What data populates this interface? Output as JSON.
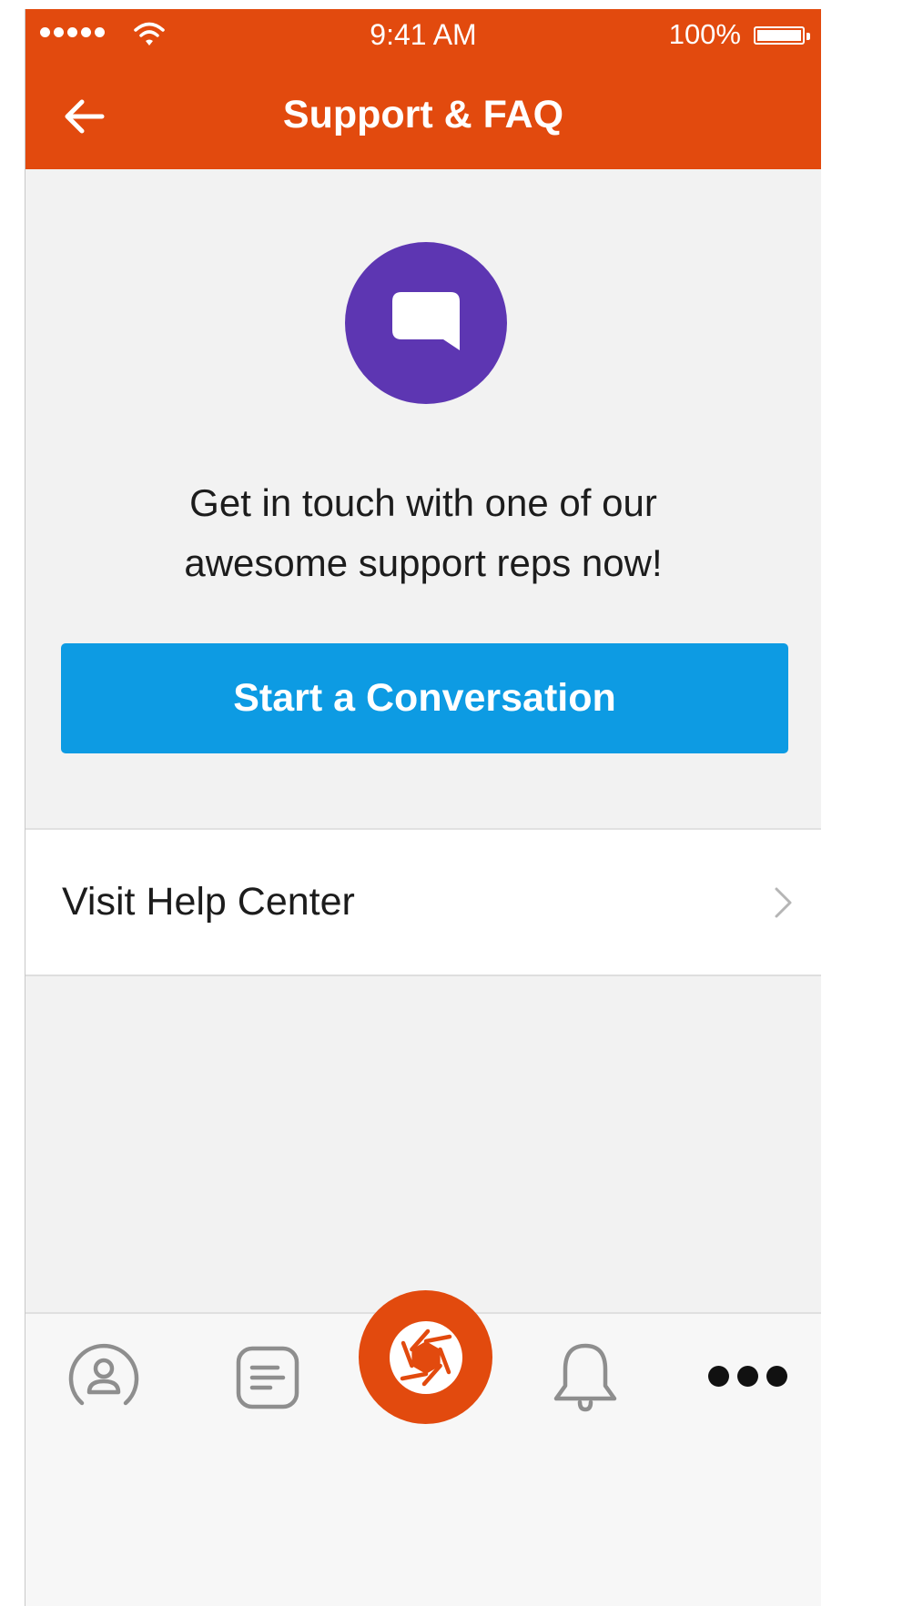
{
  "status_bar": {
    "time": "9:41 AM",
    "battery": "100%"
  },
  "header": {
    "title": "Support & FAQ",
    "back_icon": "arrow-left-icon"
  },
  "hero": {
    "icon": "chat-bubble-icon",
    "message_line1": "Get in touch with one of our",
    "message_line2": "awesome support reps now!"
  },
  "cta": {
    "label": "Start a Conversation"
  },
  "help_center": {
    "label": "Visit Help Center",
    "icon": "chevron-right-icon"
  },
  "tab_bar": {
    "tabs": [
      {
        "icon": "profile-icon"
      },
      {
        "icon": "feed-icon"
      },
      {
        "icon": "camera-shutter-icon"
      },
      {
        "icon": "bell-icon"
      },
      {
        "icon": "more-icon"
      }
    ]
  },
  "colors": {
    "brand_orange": "#e24a0e",
    "chat_purple": "#5d36b2",
    "cta_blue": "#0d9be3",
    "background": "#f2f2f2"
  }
}
